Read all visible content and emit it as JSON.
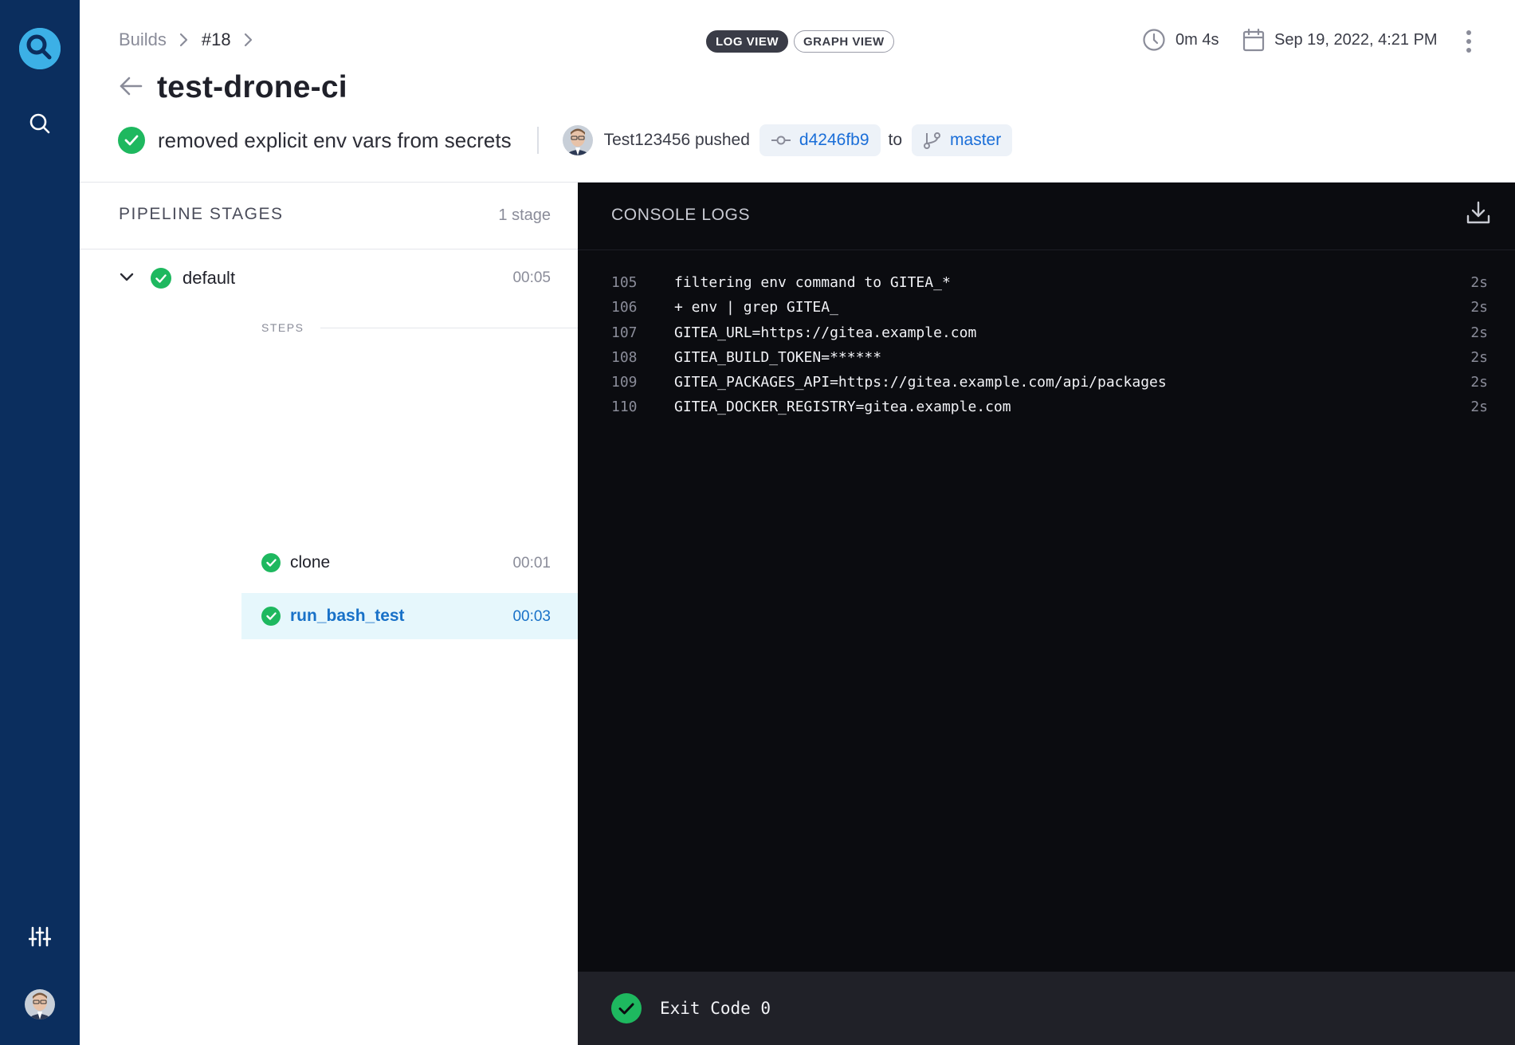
{
  "sidebar": {
    "items": [
      {
        "name": "logo",
        "icon": "drone-logo-icon"
      },
      {
        "name": "search",
        "icon": "search-icon"
      },
      {
        "name": "settings",
        "icon": "sliders-icon"
      },
      {
        "name": "user",
        "icon": "avatar"
      }
    ]
  },
  "header": {
    "breadcrumb": {
      "builds": "Builds",
      "build_number": "#18"
    },
    "view_toggle": {
      "log_view": "LOG VIEW",
      "graph_view": "GRAPH VIEW",
      "active": "log_view"
    },
    "duration": "0m 4s",
    "date": "Sep 19, 2022, 4:21 PM",
    "title": "test-drone-ci",
    "commit": {
      "message": "removed explicit env vars from secrets",
      "status": "success",
      "pusher": "Test123456 pushed",
      "sha": "d4246fb9",
      "to_label": "to",
      "branch": "master"
    }
  },
  "pipeline": {
    "heading": "PIPELINE STAGES",
    "stage_count": "1 stage",
    "stages": [
      {
        "name": "default",
        "time": "00:05",
        "status": "success",
        "steps_label": "STEPS",
        "steps": [
          {
            "name": "clone",
            "time": "00:01",
            "status": "success",
            "selected": false
          },
          {
            "name": "run_bash_test",
            "time": "00:03",
            "status": "success",
            "selected": true
          }
        ]
      }
    ]
  },
  "console": {
    "heading": "CONSOLE LOGS",
    "lines": [
      {
        "num": "105",
        "text": "filtering env command to GITEA_*",
        "time": "2s"
      },
      {
        "num": "106",
        "text": "+ env | grep GITEA_",
        "time": "2s"
      },
      {
        "num": "107",
        "text": "GITEA_URL=https://gitea.example.com",
        "time": "2s"
      },
      {
        "num": "108",
        "text": "GITEA_BUILD_TOKEN=******",
        "time": "2s"
      },
      {
        "num": "109",
        "text": "GITEA_PACKAGES_API=https://gitea.example.com/api/packages",
        "time": "2s"
      },
      {
        "num": "110",
        "text": "GITEA_DOCKER_REGISTRY=gitea.example.com",
        "time": "2s"
      }
    ],
    "exit_text": "Exit Code 0"
  },
  "colors": {
    "sidebar_bg": "#0b2e5e",
    "success": "#1eb85f",
    "link": "#1a6ed8",
    "console_bg": "#0b0c10",
    "selected_step_bg": "#e6f7fc"
  }
}
